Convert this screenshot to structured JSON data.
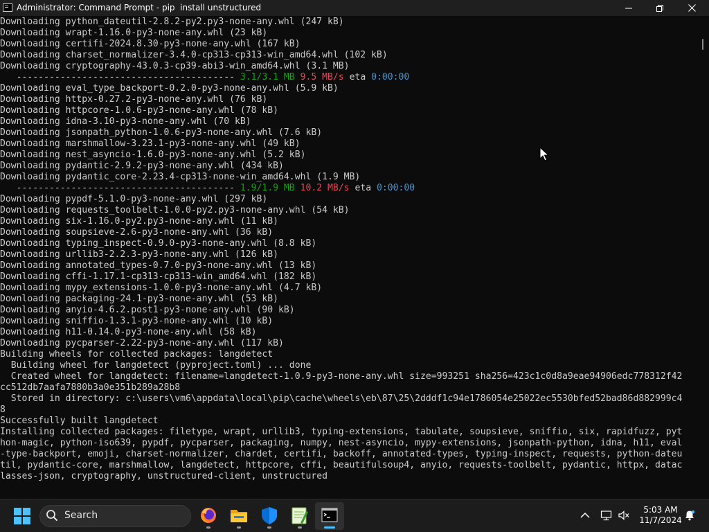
{
  "window": {
    "title": "Administrator: Command Prompt - pip  install unstructured",
    "minimize_icon": "minimize-icon",
    "maximize_icon": "maximize-icon",
    "close_icon": "close-icon"
  },
  "console": {
    "lines": [
      {
        "text": "Downloading python_dateutil-2.8.2-py2.py3-none-any.whl (247 kB)"
      },
      {
        "text": "Downloading wrapt-1.16.0-py3-none-any.whl (23 kB)"
      },
      {
        "text": "Downloading certifi-2024.8.30-py3-none-any.whl (167 kB)"
      },
      {
        "text": "Downloading charset_normalizer-3.4.0-cp313-cp313-win_amd64.whl (102 kB)"
      },
      {
        "text": "Downloading cryptography-43.0.3-cp39-abi3-win_amd64.whl (3.1 MB)"
      },
      {
        "progress": {
          "bar": "   ---------------------------------------- ",
          "size": "3.1/3.1 MB",
          "speed": "9.5 MB/s",
          "eta_label": "eta",
          "eta": "0:00:00"
        }
      },
      {
        "text": "Downloading eval_type_backport-0.2.0-py3-none-any.whl (5.9 kB)"
      },
      {
        "text": "Downloading httpx-0.27.2-py3-none-any.whl (76 kB)"
      },
      {
        "text": "Downloading httpcore-1.0.6-py3-none-any.whl (78 kB)"
      },
      {
        "text": "Downloading idna-3.10-py3-none-any.whl (70 kB)"
      },
      {
        "text": "Downloading jsonpath_python-1.0.6-py3-none-any.whl (7.6 kB)"
      },
      {
        "text": "Downloading marshmallow-3.23.1-py3-none-any.whl (49 kB)"
      },
      {
        "text": "Downloading nest_asyncio-1.6.0-py3-none-any.whl (5.2 kB)"
      },
      {
        "text": "Downloading pydantic-2.9.2-py3-none-any.whl (434 kB)"
      },
      {
        "text": "Downloading pydantic_core-2.23.4-cp313-none-win_amd64.whl (1.9 MB)"
      },
      {
        "progress": {
          "bar": "   ---------------------------------------- ",
          "size": "1.9/1.9 MB",
          "speed": "10.2 MB/s",
          "eta_label": "eta",
          "eta": "0:00:00"
        }
      },
      {
        "text": "Downloading pypdf-5.1.0-py3-none-any.whl (297 kB)"
      },
      {
        "text": "Downloading requests_toolbelt-1.0.0-py2.py3-none-any.whl (54 kB)"
      },
      {
        "text": "Downloading six-1.16.0-py2.py3-none-any.whl (11 kB)"
      },
      {
        "text": "Downloading soupsieve-2.6-py3-none-any.whl (36 kB)"
      },
      {
        "text": "Downloading typing_inspect-0.9.0-py3-none-any.whl (8.8 kB)"
      },
      {
        "text": "Downloading urllib3-2.2.3-py3-none-any.whl (126 kB)"
      },
      {
        "text": "Downloading annotated_types-0.7.0-py3-none-any.whl (13 kB)"
      },
      {
        "text": "Downloading cffi-1.17.1-cp313-cp313-win_amd64.whl (182 kB)"
      },
      {
        "text": "Downloading mypy_extensions-1.0.0-py3-none-any.whl (4.7 kB)"
      },
      {
        "text": "Downloading packaging-24.1-py3-none-any.whl (53 kB)"
      },
      {
        "text": "Downloading anyio-4.6.2.post1-py3-none-any.whl (90 kB)"
      },
      {
        "text": "Downloading sniffio-1.3.1-py3-none-any.whl (10 kB)"
      },
      {
        "text": "Downloading h11-0.14.0-py3-none-any.whl (58 kB)"
      },
      {
        "text": "Downloading pycparser-2.22-py3-none-any.whl (117 kB)"
      },
      {
        "text": "Building wheels for collected packages: langdetect"
      },
      {
        "text": "  Building wheel for langdetect (pyproject.toml) ... done"
      },
      {
        "text": "  Created wheel for langdetect: filename=langdetect-1.0.9-py3-none-any.whl size=993251 sha256=423c1c0d8a9eae94906edc778312f42"
      },
      {
        "text": "cc512db7aafa7880b3a0e351b289a28b8"
      },
      {
        "text": "  Stored in directory: c:\\users\\vm6\\appdata\\local\\pip\\cache\\wheels\\eb\\87\\25\\2dddf1c94e1786054e25022ec5530bfed52bad86d882999c4"
      },
      {
        "text": "8"
      },
      {
        "text": "Successfully built langdetect"
      },
      {
        "text": "Installing collected packages: filetype, wrapt, urllib3, typing-extensions, tabulate, soupsieve, sniffio, six, rapidfuzz, pyt"
      },
      {
        "text": "hon-magic, python-iso639, pypdf, pycparser, packaging, numpy, nest-asyncio, mypy-extensions, jsonpath-python, idna, h11, eval"
      },
      {
        "text": "-type-backport, emoji, charset-normalizer, chardet, certifi, backoff, annotated-types, typing-inspect, requests, python-dateu"
      },
      {
        "text": "til, pydantic-core, marshmallow, langdetect, httpcore, cffi, beautifulsoup4, anyio, requests-toolbelt, pydantic, httpx, datac"
      },
      {
        "text": "lasses-json, cryptography, unstructured-client, unstructured"
      }
    ]
  },
  "taskbar": {
    "start_icon": "windows-start-icon",
    "search_placeholder": "Search",
    "apps": [
      {
        "name": "firefox-icon"
      },
      {
        "name": "file-explorer-icon"
      },
      {
        "name": "windows-security-icon"
      },
      {
        "name": "notepad-plus-plus-icon"
      },
      {
        "name": "command-prompt-icon"
      }
    ],
    "tray": {
      "chevron_icon": "chevron-up-icon",
      "network_icon": "network-icon",
      "volume_icon": "volume-muted-icon",
      "bell_icon": "notification-bell-icon"
    },
    "clock": {
      "time": "5:03 AM",
      "date": "11/7/2024"
    }
  },
  "colors": {
    "console_bg": "#0c0c0c",
    "console_text": "#cccccc",
    "progress_green": "#13a10e",
    "progress_red": "#e74856",
    "progress_blue": "#3a96dd",
    "accent": "#4cc2ff"
  }
}
